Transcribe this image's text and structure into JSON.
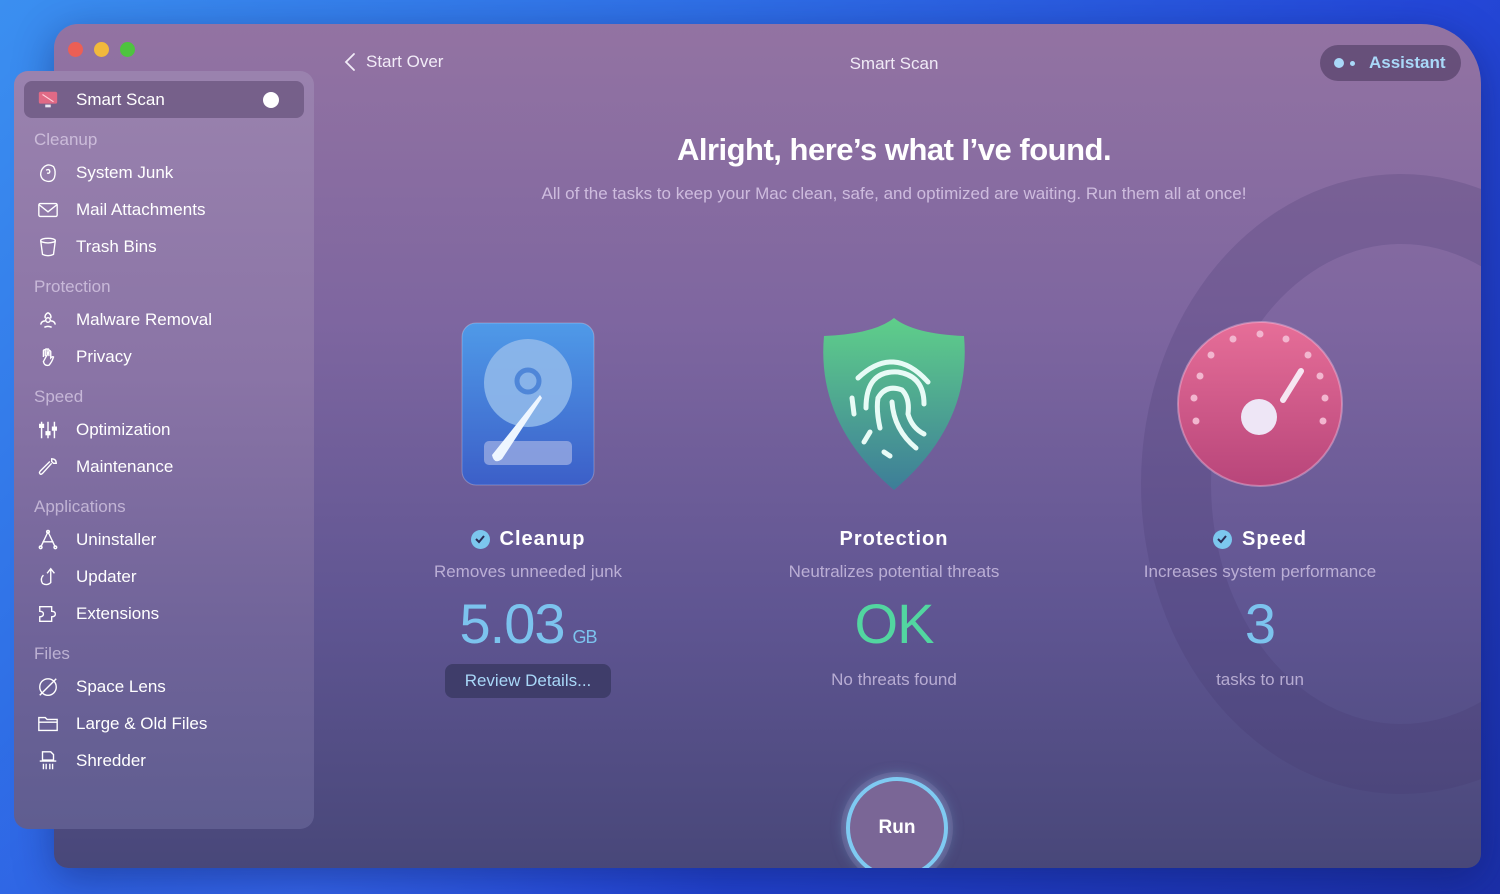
{
  "window": {
    "title": "Smart Scan",
    "back_label": "Start Over",
    "assistant_label": "Assistant"
  },
  "sidebar": {
    "active_item": {
      "label": "Smart Scan",
      "icon": "monitor-icon"
    },
    "sections": [
      {
        "header": "Cleanup",
        "items": [
          {
            "label": "System Junk",
            "icon": "system-junk-icon"
          },
          {
            "label": "Mail Attachments",
            "icon": "mail-icon"
          },
          {
            "label": "Trash Bins",
            "icon": "trash-icon"
          }
        ]
      },
      {
        "header": "Protection",
        "items": [
          {
            "label": "Malware Removal",
            "icon": "biohazard-icon"
          },
          {
            "label": "Privacy",
            "icon": "hand-icon"
          }
        ]
      },
      {
        "header": "Speed",
        "items": [
          {
            "label": "Optimization",
            "icon": "sliders-icon"
          },
          {
            "label": "Maintenance",
            "icon": "wrench-icon"
          }
        ]
      },
      {
        "header": "Applications",
        "items": [
          {
            "label": "Uninstaller",
            "icon": "uninstaller-icon"
          },
          {
            "label": "Updater",
            "icon": "update-arrow-icon"
          },
          {
            "label": "Extensions",
            "icon": "puzzle-icon"
          }
        ]
      },
      {
        "header": "Files",
        "items": [
          {
            "label": "Space Lens",
            "icon": "planet-icon"
          },
          {
            "label": "Large & Old Files",
            "icon": "folder-icon"
          },
          {
            "label": "Shredder",
            "icon": "shredder-icon"
          }
        ]
      }
    ]
  },
  "main": {
    "headline": "Alright, here’s what I’ve found.",
    "subline": "All of the tasks to keep your Mac clean, safe, and optimized are waiting. Run them all at once!",
    "cards": [
      {
        "title": "Cleanup",
        "checked": true,
        "description": "Removes unneeded junk",
        "value": "5.03",
        "unit": "GB",
        "value_color": "#7cc3ee",
        "button_label": "Review Details..."
      },
      {
        "title": "Protection",
        "checked": false,
        "description": "Neutralizes potential threats",
        "value": "OK",
        "value_color": "#52d6a0",
        "note": "No threats found"
      },
      {
        "title": "Speed",
        "checked": true,
        "description": "Increases system performance",
        "value": "3",
        "value_color": "#7cc3ee",
        "note": "tasks to run"
      }
    ],
    "run_label": "Run"
  }
}
